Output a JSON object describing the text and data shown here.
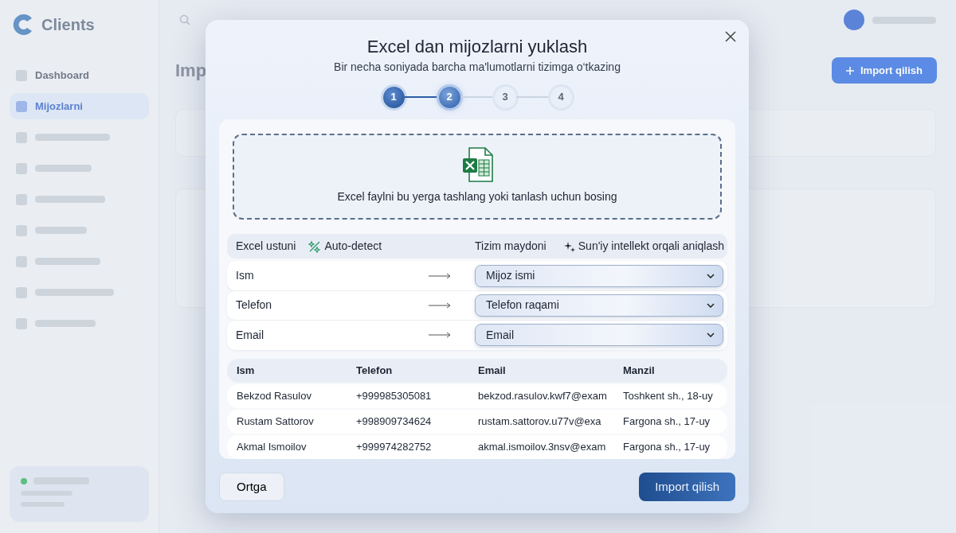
{
  "background": {
    "logo": "Clients",
    "heading": "Imp",
    "import_button": "Import qilish",
    "sidebar_items": [
      {
        "label": "Dashboard",
        "selected": false
      },
      {
        "label": "Mijozlarni",
        "selected": true
      },
      {
        "selected": false
      },
      {
        "selected": false
      },
      {
        "selected": false
      },
      {
        "selected": false
      },
      {
        "selected": false
      },
      {
        "selected": false
      },
      {
        "selected": false
      }
    ]
  },
  "modal": {
    "title": "Excel dan mijozlarni yuklash",
    "subtitle": "Bir necha soniyada barcha ma'lumotlarni tizimga o‘tkazing",
    "steps": [
      {
        "label": "1",
        "done": true,
        "selected": false
      },
      {
        "label": "2",
        "done": false,
        "selected": true
      },
      {
        "label": "3",
        "done": false,
        "selected": false
      },
      {
        "label": "4",
        "done": false,
        "selected": false
      }
    ],
    "dropzone": {
      "text": "Excel faylni bu yerga tashlang yoki tanlash uchun bosing"
    },
    "mapping": {
      "left_header": "Excel ustuni",
      "auto_detect": "Auto-detect",
      "right_header": "Tizim maydoni",
      "ai_detect": "Sun'iy intellekt orqali aniqlash",
      "rows": [
        {
          "source": "Ism",
          "target": "Mijoz ismi"
        },
        {
          "source": "Telefon",
          "target": "Telefon raqami"
        },
        {
          "source": "Email",
          "target": "Email"
        }
      ]
    },
    "preview": {
      "columns": [
        "Ism",
        "Telefon",
        "Email",
        "Manzil"
      ],
      "rows": [
        [
          "Bekzod Rasulov",
          "+999985305081",
          "bekzod.rasulov.kwf7@exam",
          "Toshkent sh., 18-uy"
        ],
        [
          "Rustam Sattorov",
          "+998909734624",
          "rustam.sattorov.u77v@exa",
          "Fargona sh., 17-uy"
        ],
        [
          "Akmal Ismoilov",
          "+999974282752",
          "akmal.ismoilov.3nsv@exam",
          "Fargona sh., 17-uy"
        ]
      ]
    },
    "back_button": "Ortga",
    "import_button": "Import qilish"
  }
}
